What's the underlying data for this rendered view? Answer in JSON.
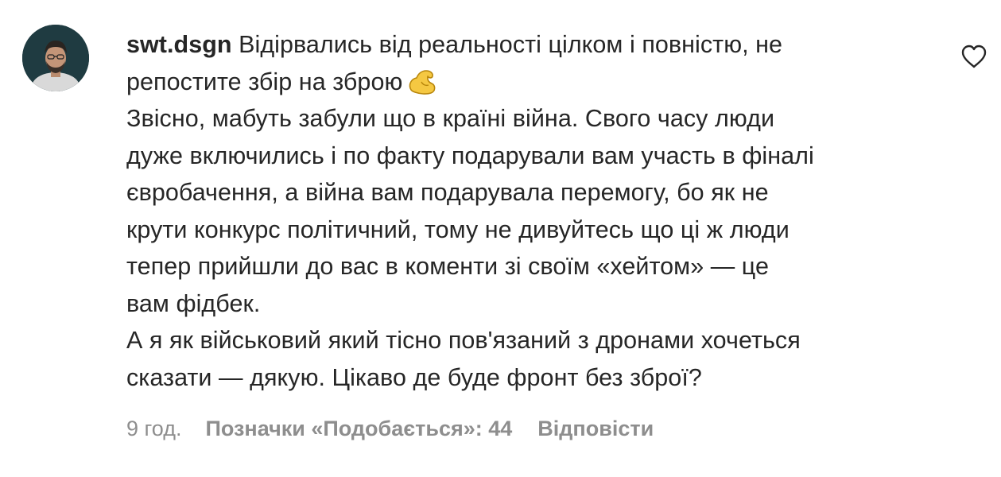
{
  "comment": {
    "username": "swt.dsgn",
    "lines": [
      "Відірвались від реальності цілком і повністю, не",
      "репостите збір на зброю",
      "Звісно, мабуть забули що в країні війна. Свого часу люди",
      "дуже включились і по факту подарували вам участь в фіналі",
      "євробачення, а війна вам подарувала перемогу, бо як не",
      "крути конкурс політичний, тому не дивуйтесь що ці ж люди",
      "тепер прийшли до вас в коменти зі своїм «хейтом» — це",
      "вам фідбек.",
      "А я як військовий який тісно пов'язаний з дронами хочеться",
      "сказати — дякую. Цікаво де буде фронт без зброї?"
    ],
    "emoji_icon": "flexed-biceps-icon"
  },
  "meta": {
    "time": "9 год.",
    "likes": "Позначки «Подобається»: 44",
    "reply": "Відповісти"
  },
  "icons": {
    "like": "heart-outline-icon",
    "avatar": "avatar"
  },
  "colors": {
    "text": "#262626",
    "meta_text": "#8e8e8e",
    "emoji_yellow": "#f5c842"
  }
}
